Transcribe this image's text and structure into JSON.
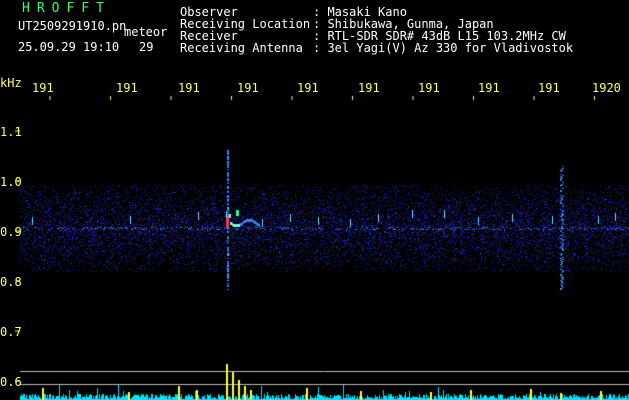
{
  "header": {
    "brand": "HROFFT",
    "filename": "UT2509291910.pn",
    "tag": "meteor",
    "timestamp": "25.09.29 19:10",
    "count": "29",
    "info": [
      {
        "label": "Observer",
        "value": ": Masaki Kano"
      },
      {
        "label": "Receiving Location",
        "value": ": Shibukawa, Gunma, Japan"
      },
      {
        "label": "Receiver",
        "value": ": RTL-SDR SDR# 43dB L15 103.2MHz CW"
      },
      {
        "label": "Receiving Antenna",
        "value": ": 3el Yagi(V) Az 330 for Vladivostok"
      }
    ]
  },
  "axis": {
    "unit": "kHz",
    "x_ticks": [
      "191",
      "191",
      "191",
      "191",
      "191",
      "191",
      "191",
      "191",
      "191",
      "1920"
    ],
    "y_ticks": [
      "1.1",
      "1.0",
      "0.9",
      "0.8",
      "0.7",
      "0.6"
    ]
  },
  "colors": {
    "label": "#ffff66",
    "brand": "#33ff66",
    "signal": "#1a3cff",
    "hot": "#ff3355",
    "level": "#00e5ff"
  }
}
